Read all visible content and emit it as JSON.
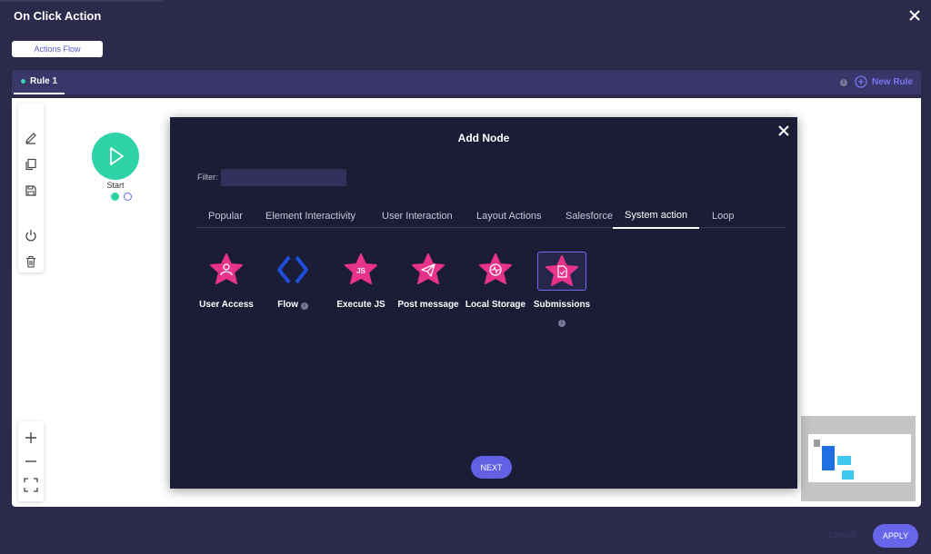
{
  "window": {
    "title": "On Click Action"
  },
  "header": {
    "flow_button": "Actions Flow"
  },
  "rules": {
    "tabs": [
      {
        "label": "Rule 1"
      }
    ],
    "new_rule_label": "New Rule"
  },
  "canvas": {
    "start_label": "Start",
    "toolbar": [
      "edit-icon",
      "copy-icon",
      "save-icon",
      "power-icon",
      "trash-icon"
    ],
    "zoom": [
      "zoom-in-icon",
      "zoom-out-icon",
      "fit-screen-icon"
    ]
  },
  "modal": {
    "title": "Add Node",
    "filter_label": "Filter:",
    "filter_value": "",
    "tabs": [
      "Popular",
      "Element Interactivity",
      "User Interaction",
      "Layout Actions",
      "Salesforce",
      "System action",
      "Loop"
    ],
    "active_tab": "System action",
    "nodes": [
      {
        "label": "User Access",
        "icon": "user-access-icon"
      },
      {
        "label": "Flow",
        "icon": "flow-icon"
      },
      {
        "label": "Execute JS",
        "icon": "execute-js-icon"
      },
      {
        "label": "Post message",
        "icon": "post-message-icon"
      },
      {
        "label": "Local Storage",
        "icon": "local-storage-icon"
      },
      {
        "label": "Submissions",
        "icon": "submissions-icon"
      }
    ],
    "js_badge": "JS",
    "next_label": "NEXT"
  },
  "footer": {
    "cancel_label": "Cancel",
    "apply_label": "APPLY"
  },
  "colors": {
    "accent": "#6765ea",
    "node_pink": "#e8338a",
    "start_green": "#2dd3a6",
    "flow_blue": "#1e4ed8"
  }
}
